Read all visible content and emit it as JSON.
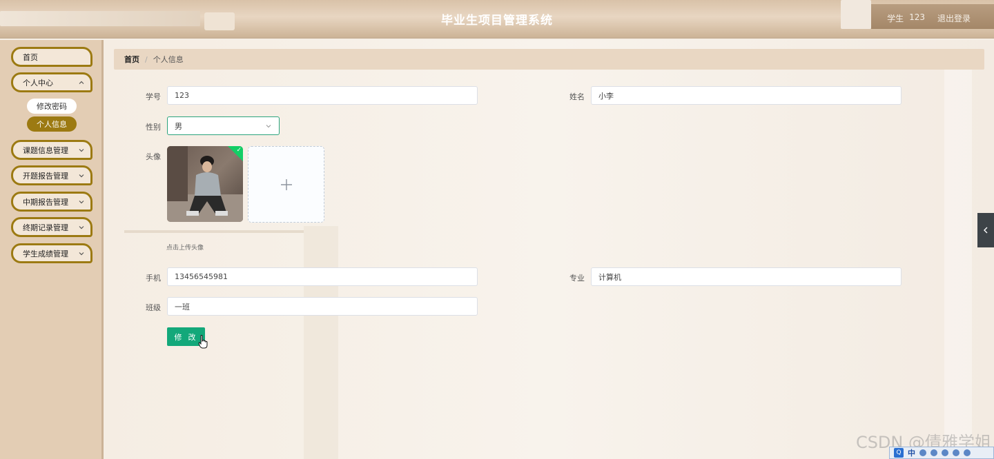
{
  "header": {
    "title": "毕业生项目管理系统",
    "role": "学生",
    "username": "123",
    "logout": "退出登录"
  },
  "sidebar": {
    "items": [
      {
        "label": "首页",
        "expandable": false
      },
      {
        "label": "个人中心",
        "expandable": true,
        "expanded": true,
        "children": [
          {
            "label": "修改密码",
            "active": false
          },
          {
            "label": "个人信息",
            "active": true
          }
        ]
      },
      {
        "label": "课题信息管理",
        "expandable": true
      },
      {
        "label": "开题报告管理",
        "expandable": true
      },
      {
        "label": "中期报告管理",
        "expandable": true
      },
      {
        "label": "终期记录管理",
        "expandable": true
      },
      {
        "label": "学生成绩管理",
        "expandable": true
      }
    ]
  },
  "breadcrumb": {
    "home": "首页",
    "separator": "/",
    "current": "个人信息"
  },
  "form": {
    "student_id": {
      "label": "学号",
      "value": "123"
    },
    "name": {
      "label": "姓名",
      "value": "小李"
    },
    "gender": {
      "label": "性别",
      "value": "男"
    },
    "avatar": {
      "label": "头像",
      "hint": "点击上传头像",
      "upload_symbol": "+"
    },
    "phone": {
      "label": "手机",
      "value": "13456545981"
    },
    "major": {
      "label": "专业",
      "value": "计算机"
    },
    "class": {
      "label": "班级",
      "value": "一班"
    },
    "submit": "修 改"
  },
  "watermark": "CSDN @倩雅学姐",
  "ime": {
    "logo": "Q",
    "mode": "中"
  },
  "colors": {
    "accent": "#9c7a12",
    "primary_button": "#13a87a",
    "success_check": "#13ce66",
    "select_border": "#2aa37c"
  }
}
